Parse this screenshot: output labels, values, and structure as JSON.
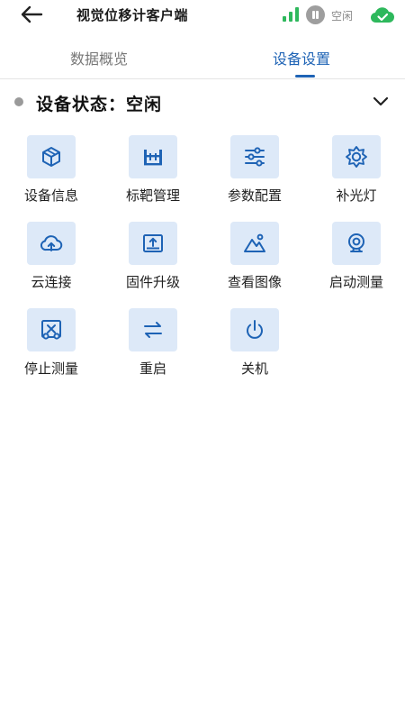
{
  "header": {
    "title": "视觉位移计客户端",
    "status_label": "空闲"
  },
  "tabs": [
    {
      "label": "数据概览",
      "active": false
    },
    {
      "label": "设备设置",
      "active": true
    }
  ],
  "device_status": {
    "label": "设备状态：空闲"
  },
  "functions": [
    {
      "label": "设备信息",
      "icon": "cube-icon"
    },
    {
      "label": "标靶管理",
      "icon": "target-icon"
    },
    {
      "label": "参数配置",
      "icon": "sliders-icon"
    },
    {
      "label": "补光灯",
      "icon": "light-icon"
    },
    {
      "label": "云连接",
      "icon": "cloud-upload-icon"
    },
    {
      "label": "固件升级",
      "icon": "firmware-upgrade-icon"
    },
    {
      "label": "查看图像",
      "icon": "image-icon"
    },
    {
      "label": "启动测量",
      "icon": "camera-icon"
    },
    {
      "label": "停止测量",
      "icon": "stop-measure-icon"
    },
    {
      "label": "重启",
      "icon": "restart-icon"
    },
    {
      "label": "关机",
      "icon": "power-icon"
    }
  ],
  "colors": {
    "accent": "#1e63b5",
    "tile_bg": "#dde9f8",
    "status_green": "#2eb85c",
    "status_gray": "#9e9e9e"
  }
}
